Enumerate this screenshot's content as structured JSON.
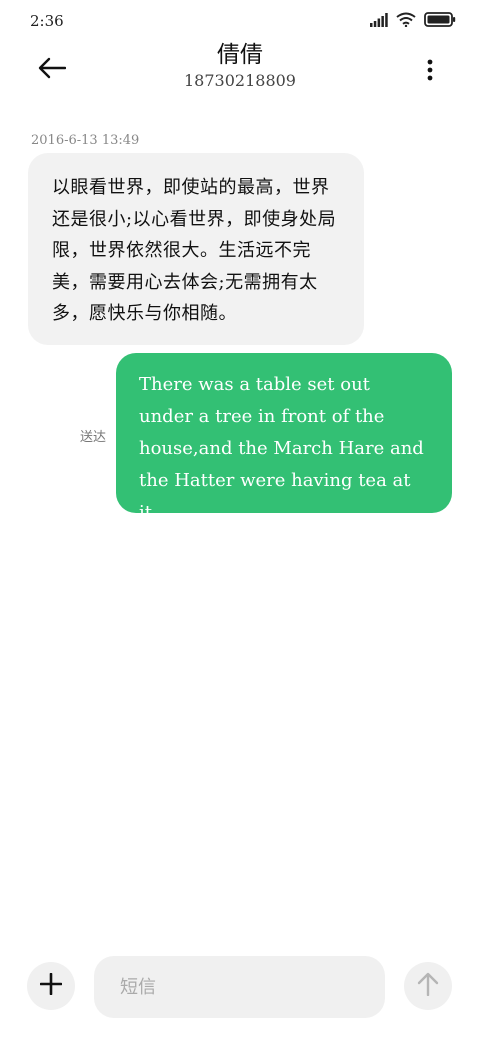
{
  "status_bar": {
    "time": "2:36",
    "icons": [
      "signal-icon",
      "wifi-icon",
      "battery-icon"
    ]
  },
  "header": {
    "contact_name": "倩倩",
    "phone_number": "18730218809",
    "back_icon": "back-arrow-icon",
    "menu_icon": "more-vertical-icon"
  },
  "conversation": {
    "timestamp": "2016-6-13 13:49",
    "incoming_message": "以眼看世界，即使站的最高，世界还是很小;以心看世界，即使身处局限，世界依然很大。生活远不完美，需要用心去体会;无需拥有太多，愿快乐与你相随。",
    "outgoing_message": "There was a table set out under a tree in front of the house,and the March Hare and the Hatter were having tea at it.",
    "delivery_status": "送达"
  },
  "composer": {
    "placeholder": "短信",
    "value": "",
    "add_icon": "plus-icon",
    "send_icon": "arrow-up-icon"
  },
  "colors": {
    "outgoing_bubble": "#33c074",
    "incoming_bubble": "#f2f2f2",
    "input_background": "#f0f0f0"
  }
}
